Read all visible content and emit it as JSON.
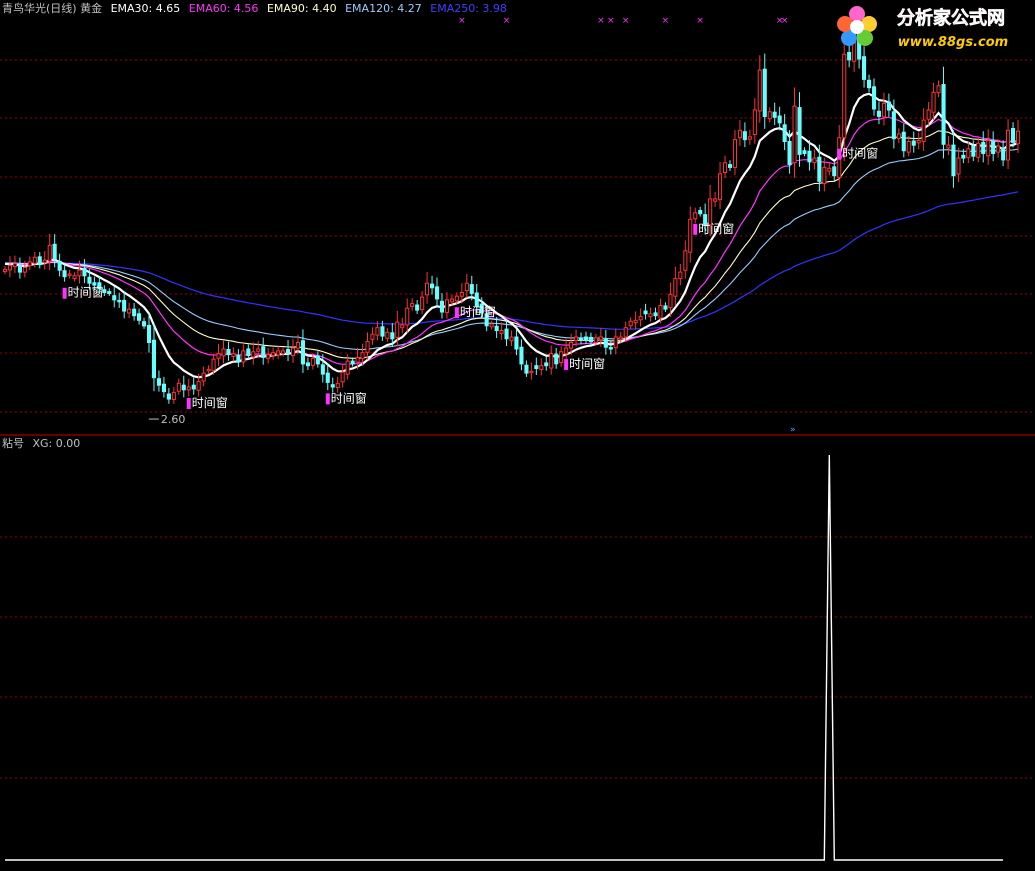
{
  "header": {
    "title": "青鸟华光(日线) 黄金",
    "ema_items": [
      {
        "label": "EMA30: 4.65",
        "color": "#ffffff"
      },
      {
        "label": "EMA60: 4.56",
        "color": "#ff33ff"
      },
      {
        "label": "EMA90: 4.40",
        "color": "#ffffcc"
      },
      {
        "label": "EMA120: 4.27",
        "color": "#99ccff"
      },
      {
        "label": "EMA250: 3.98",
        "color": "#3333ff"
      }
    ]
  },
  "indicator_header": {
    "name": "粘号",
    "value": "XG: 0.00"
  },
  "logo": {
    "name": "分析家公式网",
    "url_text": "www.88gs.com"
  },
  "colors": {
    "background": "#000000",
    "up_candle": "#ff3333",
    "down_candle": "#66ffff",
    "grid": "#990000",
    "separator": "#cc0000",
    "marker_label_bg": "#ff33ff",
    "signal_line": "#ffffff"
  },
  "chart_data": [
    {
      "type": "candlestick",
      "title": "青鸟华光(日线) 黄金",
      "ylim": [
        2.4,
        6.9
      ],
      "low_label": "2.60",
      "annotations": [
        {
          "label": "时间窗",
          "bar": 12
        },
        {
          "label": "时间窗",
          "bar": 37
        },
        {
          "label": "时间窗",
          "bar": 65
        },
        {
          "label": "时间窗",
          "bar": 91
        },
        {
          "label": "时间窗",
          "bar": 113
        },
        {
          "label": "时间窗",
          "bar": 139
        },
        {
          "label": "时间窗",
          "bar": 168
        }
      ],
      "close": [
        4.08,
        4.12,
        4.14,
        4.05,
        4.1,
        4.16,
        4.21,
        4.13,
        4.18,
        4.34,
        4.19,
        4.07,
        4.0,
        4.03,
        4.01,
        4.07,
        4.01,
        3.93,
        3.91,
        3.87,
        3.83,
        3.82,
        3.75,
        3.73,
        3.63,
        3.65,
        3.58,
        3.53,
        3.47,
        3.29,
        2.91,
        2.83,
        2.76,
        2.68,
        2.75,
        2.85,
        2.78,
        2.81,
        2.79,
        2.87,
        2.96,
        3.0,
        3.11,
        3.17,
        3.22,
        3.16,
        3.17,
        3.08,
        3.2,
        3.15,
        3.19,
        3.22,
        3.13,
        3.16,
        3.18,
        3.2,
        3.2,
        3.17,
        3.23,
        3.29,
        3.06,
        3.04,
        3.12,
        3.06,
        2.95,
        2.86,
        2.81,
        2.85,
        2.97,
        3.09,
        3.06,
        3.13,
        3.18,
        3.3,
        3.38,
        3.45,
        3.36,
        3.4,
        3.33,
        3.51,
        3.48,
        3.66,
        3.71,
        3.64,
        3.78,
        3.93,
        3.88,
        3.76,
        3.62,
        3.75,
        3.76,
        3.79,
        3.83,
        3.93,
        3.82,
        3.68,
        3.61,
        3.47,
        3.49,
        3.42,
        3.42,
        3.33,
        3.35,
        3.22,
        3.06,
        2.96,
        2.98,
        3.01,
        3.04,
        3.04,
        3.17,
        3.06,
        3.19,
        3.23,
        3.29,
        3.35,
        3.32,
        3.32,
        3.3,
        3.34,
        3.35,
        3.24,
        3.22,
        3.35,
        3.35,
        3.45,
        3.52,
        3.53,
        3.57,
        3.6,
        3.6,
        3.58,
        3.69,
        3.65,
        3.81,
        3.98,
        4.05,
        4.28,
        4.62,
        4.69,
        4.68,
        4.55,
        4.84,
        4.84,
        5.11,
        5.23,
        5.18,
        5.48,
        5.58,
        5.48,
        5.51,
        5.8,
        6.23,
        5.73,
        5.78,
        5.72,
        5.66,
        5.46,
        5.21,
        5.84,
        5.32,
        5.33,
        5.24,
        5.28,
        5.03,
        5.18,
        5.17,
        5.09,
        5.5,
        6.4,
        6.34,
        6.62,
        6.35,
        6.13,
        6.04,
        5.81,
        5.73,
        5.87,
        5.8,
        5.49,
        5.54,
        5.36,
        5.46,
        5.42,
        5.47,
        5.69,
        5.8,
        5.99,
        6.06,
        5.43,
        5.42,
        5.09,
        5.28,
        5.28,
        5.38,
        5.3,
        5.44,
        5.33,
        5.47,
        5.33,
        5.41,
        5.26,
        5.58,
        5.45,
        5.57
      ]
    },
    {
      "type": "line",
      "name": "XG",
      "ylim": [
        0,
        1
      ],
      "x": [
        0,
        165,
        166,
        167,
        201
      ],
      "y": [
        0,
        0,
        1,
        0,
        0
      ]
    }
  ]
}
